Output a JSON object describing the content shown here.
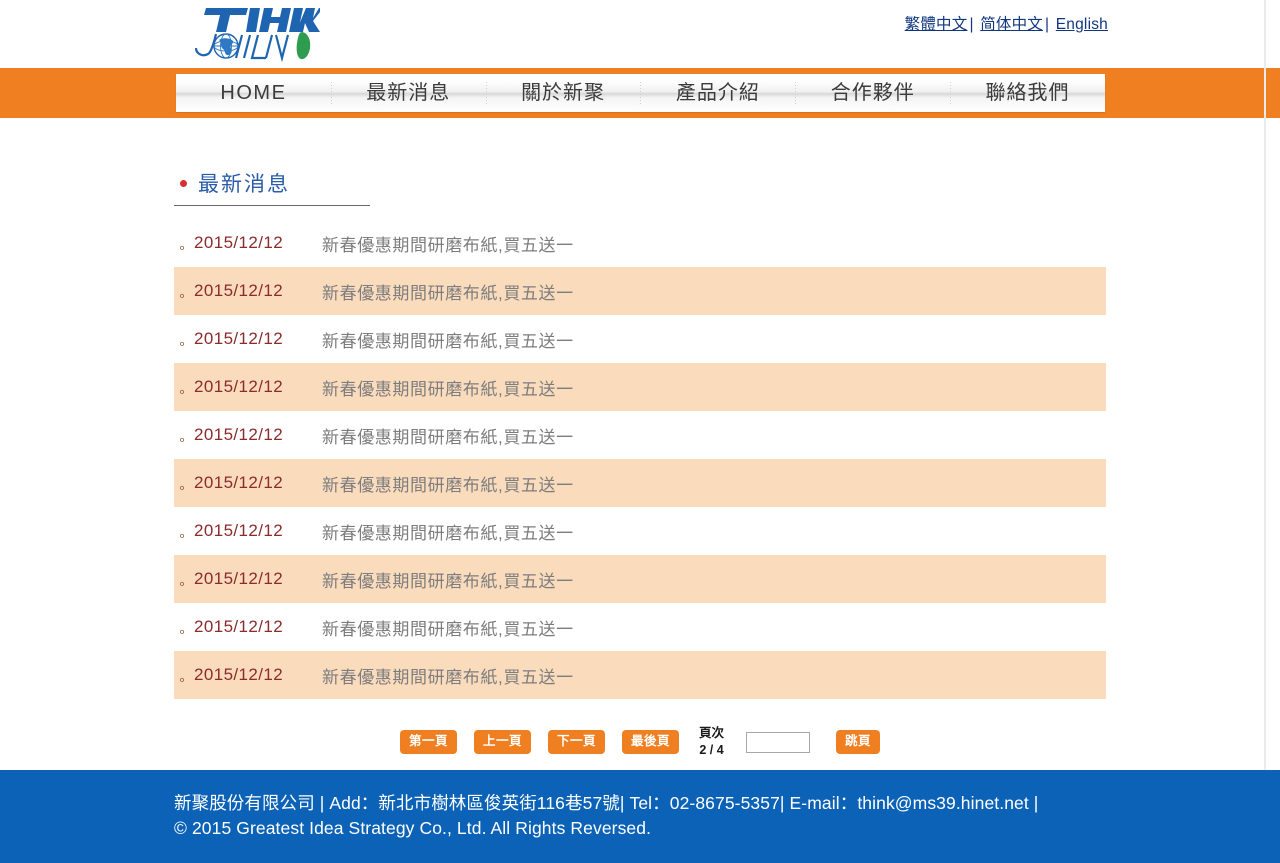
{
  "header": {
    "logo": {
      "top_text": "THINK",
      "bottom_text": "JOIN",
      "alt": "Think Join logo"
    },
    "languages": [
      {
        "label": "繁體中文",
        "sep": "|"
      },
      {
        "label": "简体中文",
        "sep": "|"
      },
      {
        "label": "English",
        "sep": ""
      }
    ]
  },
  "nav": {
    "items": [
      {
        "label": "HOME"
      },
      {
        "label": "最新消息"
      },
      {
        "label": "關於新聚"
      },
      {
        "label": "產品介紹"
      },
      {
        "label": "合作夥伴"
      },
      {
        "label": "聯絡我們"
      }
    ]
  },
  "main": {
    "section_title": "最新消息",
    "news": [
      {
        "date": "2015/12/12",
        "title": "新春優惠期間研磨布紙,買五送一"
      },
      {
        "date": "2015/12/12",
        "title": "新春優惠期間研磨布紙,買五送一"
      },
      {
        "date": "2015/12/12",
        "title": "新春優惠期間研磨布紙,買五送一"
      },
      {
        "date": "2015/12/12",
        "title": "新春優惠期間研磨布紙,買五送一"
      },
      {
        "date": "2015/12/12",
        "title": "新春優惠期間研磨布紙,買五送一"
      },
      {
        "date": "2015/12/12",
        "title": "新春優惠期間研磨布紙,買五送一"
      },
      {
        "date": "2015/12/12",
        "title": "新春優惠期間研磨布紙,買五送一"
      },
      {
        "date": "2015/12/12",
        "title": "新春優惠期間研磨布紙,買五送一"
      },
      {
        "date": "2015/12/12",
        "title": "新春優惠期間研磨布紙,買五送一"
      },
      {
        "date": "2015/12/12",
        "title": "新春優惠期間研磨布紙,買五送一"
      }
    ],
    "bullet_glyph": "。"
  },
  "pagination": {
    "first_label": "第一頁",
    "prev_label": "上一頁",
    "next_label": "下一頁",
    "last_label": "最後頁",
    "page_info_label": "頁次",
    "page_info_value": "2 / 4",
    "input_value": "",
    "input_placeholder": "",
    "jump_label": "跳頁"
  },
  "footer": {
    "line1": "新聚股份有限公司 | Add：新北市樹林區俊英街116巷57號| Tel：02-8675-5357| E-mail：think@ms39.hinet.net |",
    "line2": "© 2015 Greatest Idea Strategy Co., Ltd. All Rights Reversed."
  },
  "colors": {
    "accent_orange": "#ef7f20",
    "footer_blue": "#0b62b6",
    "title_blue": "#2b5ca8",
    "row_alt": "#fadcbd",
    "date_red": "#8c2b2b"
  }
}
